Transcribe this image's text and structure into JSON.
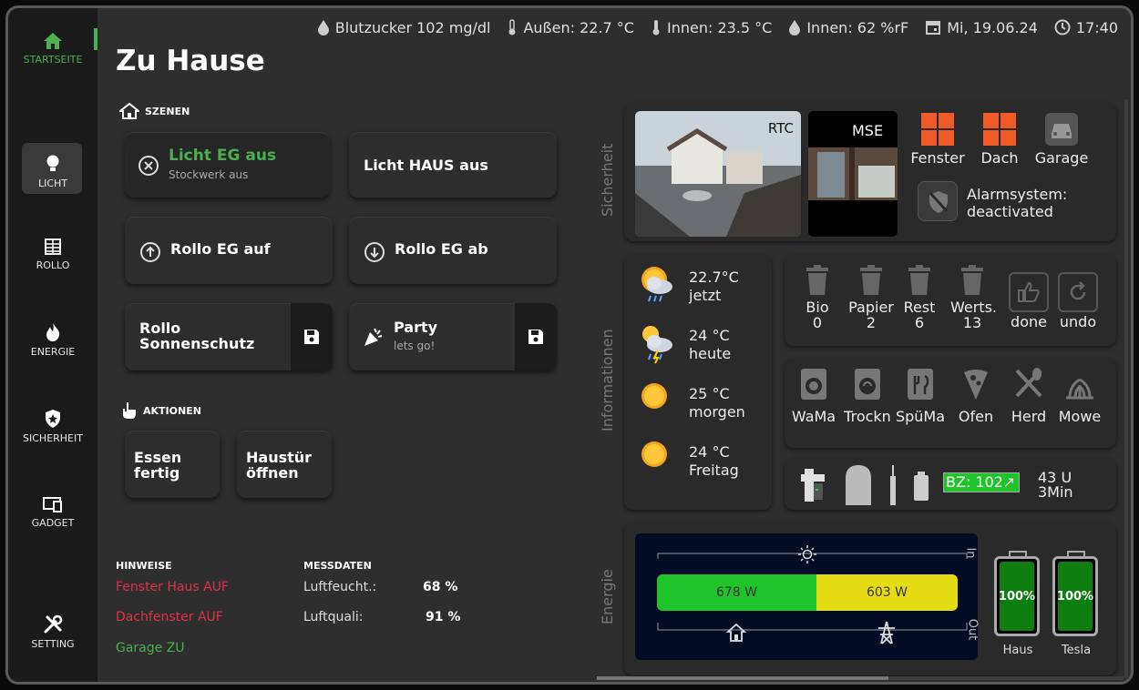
{
  "topbar": {
    "blutzucker": "Blutzucker 102 mg/dl",
    "aussen": "Außen: 22.7 °C",
    "innen_temp": "Innen: 23.5 °C",
    "innen_feucht": "Innen: 62 %rF",
    "datum": "Mi, 19.06.24",
    "zeit": "17:40"
  },
  "sidebar": [
    {
      "label": "STARTSEITE",
      "icon": "home-icon"
    },
    {
      "label": "LICHT",
      "icon": "bulb-icon"
    },
    {
      "label": "ROLLO",
      "icon": "shutter-icon"
    },
    {
      "label": "ENERGIE",
      "icon": "flame-icon"
    },
    {
      "label": "SICHERHEIT",
      "icon": "shield-icon"
    },
    {
      "label": "GADGET",
      "icon": "devices-icon"
    },
    {
      "label": "SETTING",
      "icon": "tools-icon"
    }
  ],
  "page_title": "Zu Hause",
  "scenes": {
    "heading": "SZENEN",
    "licht_eg": {
      "title": "Licht EG aus",
      "sub": "Stockwerk aus"
    },
    "licht_haus": "Licht HAUS aus",
    "rollo_auf": "Rollo EG auf",
    "rollo_ab": "Rollo EG ab",
    "rollo_sonne": "Rollo Sonnenschutz",
    "party": {
      "title": "Party",
      "sub": "lets go!"
    }
  },
  "actions": {
    "heading": "AKTIONEN",
    "essen": "Essen fertig",
    "haustuer": "Haustür öffnen"
  },
  "hinweise": {
    "heading": "HINWEISE",
    "items": [
      "Fenster Haus AUF",
      "Dachfenster AUF",
      "Garage ZU"
    ]
  },
  "messdaten": {
    "heading": "MESSDATEN",
    "rows": [
      {
        "label": "Luftfeucht.:",
        "value": "68 %"
      },
      {
        "label": "Luftquali:",
        "value": "91 %"
      }
    ]
  },
  "sicherheit": {
    "label": "Sicherheit",
    "cam1": "RTC",
    "cam2": "MSE",
    "fenster": "Fenster",
    "dach": "Dach",
    "garage": "Garage",
    "alarm": "Alarmsystem: deactivated"
  },
  "informationen": {
    "label": "Informationen",
    "weather": [
      {
        "temp": "22.7°C",
        "day": "jetzt"
      },
      {
        "temp": "24 °C",
        "day": "heute"
      },
      {
        "temp": "25 °C",
        "day": "morgen"
      },
      {
        "temp": "24 °C",
        "day": "Freitag"
      }
    ],
    "bins": [
      {
        "name": "Bio",
        "count": "0"
      },
      {
        "name": "Papier",
        "count": "2"
      },
      {
        "name": "Rest",
        "count": "6"
      },
      {
        "name": "Werts.",
        "count": "13"
      }
    ],
    "done": "done",
    "undo": "undo",
    "appliances": [
      "WaMa",
      "Trockn",
      "SpüMa",
      "Ofen",
      "Herd",
      "Mowe"
    ],
    "bz": "BZ: 102",
    "bz_arrow": "↗",
    "bz_time": "43 U 3Min"
  },
  "energie": {
    "label": "Energie",
    "in": "In",
    "out": "Out",
    "house_w": "678 W",
    "grid_w": "603 W",
    "house_fraction": 0.53,
    "batteries": [
      {
        "name": "Haus",
        "pct": "100%"
      },
      {
        "name": "Tesla",
        "pct": "100%"
      }
    ]
  },
  "colors": {
    "green": "#4caf50",
    "red": "#e0304a",
    "orange": "#f05a28",
    "bar_green": "#1fc32a",
    "bar_yellow": "#e6dc14"
  }
}
